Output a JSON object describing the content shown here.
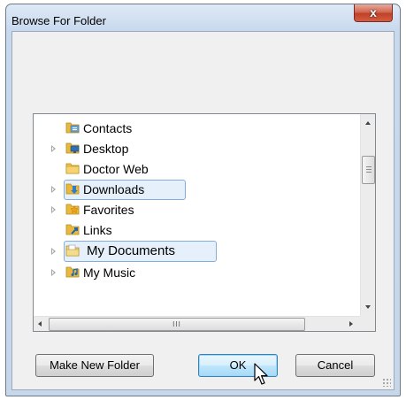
{
  "window": {
    "title": "Browse For Folder",
    "close_glyph": "x"
  },
  "tree": {
    "items": [
      {
        "label": "Contacts",
        "icon": "contacts-folder-icon",
        "expandable": false
      },
      {
        "label": "Desktop",
        "icon": "desktop-folder-icon",
        "expandable": true
      },
      {
        "label": "Doctor Web",
        "icon": "folder-icon",
        "expandable": false
      },
      {
        "label": "Downloads",
        "icon": "downloads-folder-icon",
        "expandable": true,
        "state": "hover"
      },
      {
        "label": "Favorites",
        "icon": "favorites-folder-icon",
        "expandable": true
      },
      {
        "label": "Links",
        "icon": "links-folder-icon",
        "expandable": false
      },
      {
        "label": "My Documents",
        "icon": "documents-folder-icon",
        "expandable": true,
        "state": "selected"
      },
      {
        "label": "My Music",
        "icon": "music-folder-icon",
        "expandable": true
      }
    ],
    "hscroll_thumb_glyph": "III"
  },
  "buttons": {
    "make_new_folder": "Make New Folder",
    "ok": "OK",
    "cancel": "Cancel"
  },
  "colors": {
    "title_bar": "#c8d9ee",
    "close_button": "#c1402a",
    "selection_border": "#84acdd",
    "ok_button": "#bee6fd"
  }
}
